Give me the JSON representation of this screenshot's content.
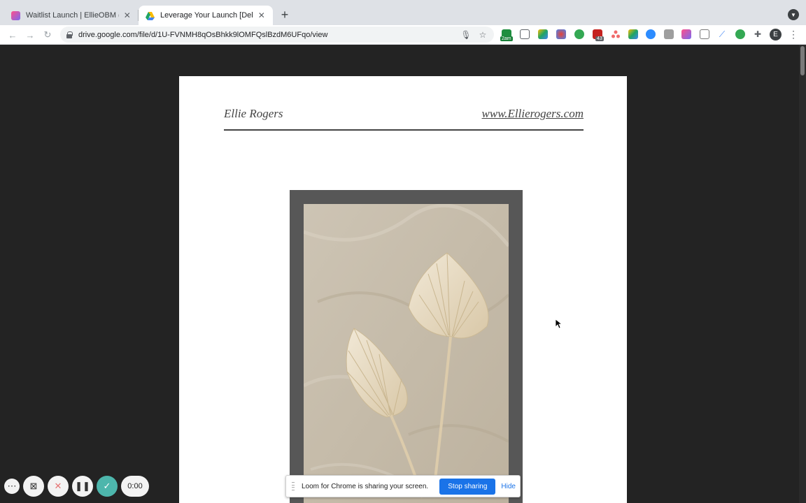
{
  "browser": {
    "tabs": [
      {
        "title": "Waitlist Launch | EllieOBM (Bo",
        "active": false,
        "favicon_color": "#8e44ad"
      },
      {
        "title": "Leverage Your Launch [Deliver",
        "active": true,
        "favicon_color": "#1a73e8"
      }
    ],
    "url": "drive.google.com/file/d/1U-FVNMH8qOsBhkk9lOMFQslBzdM6UFqo/view",
    "extension_badges": {
      "calendar": "2am",
      "mail": "43"
    },
    "profile_initial": "E"
  },
  "document": {
    "header_left": "Ellie Rogers",
    "header_right": "www.Ellierogers.com"
  },
  "loom": {
    "timer": "0:00",
    "share_text": "Loom for Chrome is sharing your screen.",
    "stop_label": "Stop sharing",
    "hide_label": "Hide"
  }
}
